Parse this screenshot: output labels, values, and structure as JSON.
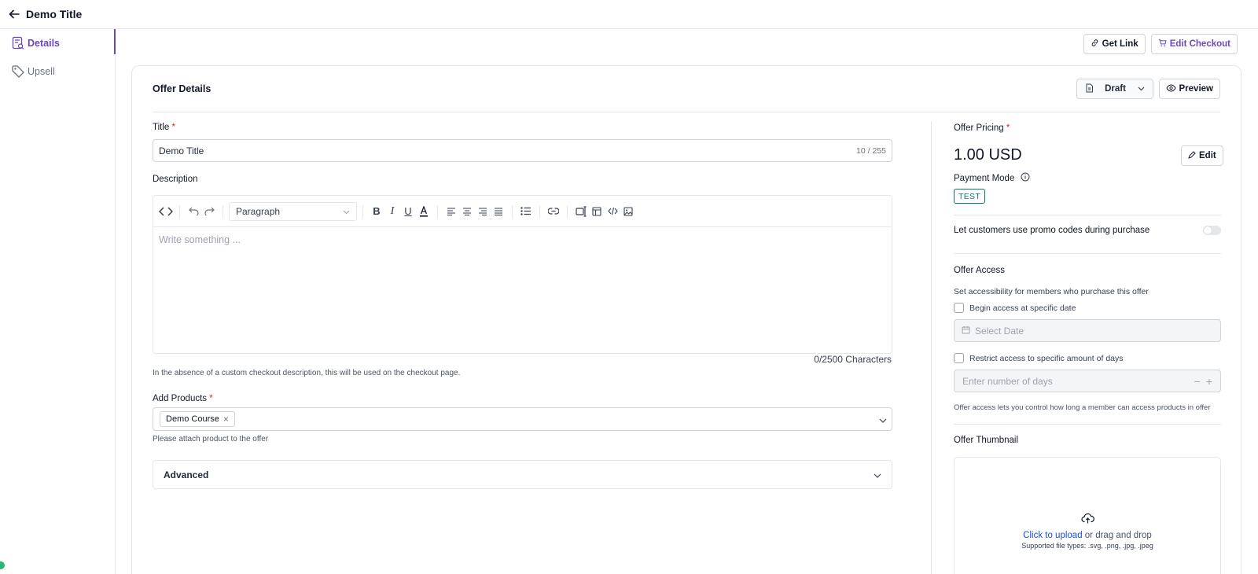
{
  "header": {
    "title": "Demo Title"
  },
  "sidebar": {
    "items": [
      {
        "label": "Details",
        "active": true,
        "icon": "document-search-icon"
      },
      {
        "label": "Upsell",
        "active": false,
        "icon": "tag-icon"
      }
    ]
  },
  "actions": {
    "get_link": "Get Link",
    "edit_checkout": "Edit Checkout"
  },
  "card": {
    "title": "Offer Details",
    "status": "Draft",
    "preview": "Preview"
  },
  "form": {
    "title_label": "Title",
    "required_mark": "*",
    "title_value": "Demo Title",
    "title_counter": "10 / 255",
    "description_label": "Description",
    "paragraph_option": "Paragraph",
    "description_placeholder": "Write something ...",
    "char_count": "0/2500 Characters",
    "description_help": "In the absence of a custom checkout description, this will be used on the checkout page.",
    "products_label": "Add Products",
    "product_chip": "Demo Course",
    "products_help": "Please attach product to the offer",
    "advanced_label": "Advanced"
  },
  "pricing": {
    "label": "Offer Pricing",
    "price": "1.00 USD",
    "edit": "Edit",
    "payment_mode_label": "Payment Mode",
    "payment_mode_badge": "TEST",
    "promo_label": "Let customers use promo codes during purchase",
    "promo_enabled": false
  },
  "access": {
    "title": "Offer Access",
    "description": "Set accessibility for members who purchase this offer",
    "begin_label": "Begin access at specific date",
    "date_placeholder": "Select Date",
    "restrict_label": "Restrict access to specific amount of days",
    "days_placeholder": "Enter number of days",
    "help": "Offer access lets you control how long a member can access products in offer"
  },
  "thumbnail": {
    "title": "Offer Thumbnail",
    "upload_link": "Click to upload",
    "upload_rest": " or drag and drop",
    "supported": "Supported file types: .svg, .png, .jpg, .jpeg"
  },
  "colors": {
    "accent": "#6b46c1",
    "badge": "#0f766e",
    "link": "#1d4ed8"
  }
}
